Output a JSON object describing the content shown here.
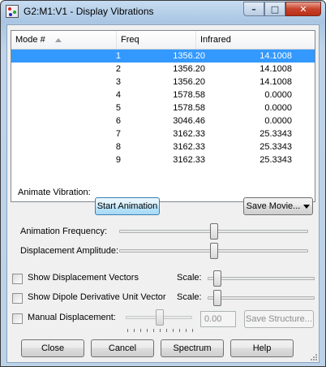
{
  "window": {
    "title": "G2:M1:V1 - Display Vibrations",
    "controls": {
      "minimize": "–",
      "maximize": "□",
      "close": "✕"
    }
  },
  "table": {
    "columns": [
      "Mode #",
      "Freq",
      "Infrared"
    ],
    "rows": [
      {
        "mode": "1",
        "freq": "1356.20",
        "ir": "14.1008"
      },
      {
        "mode": "2",
        "freq": "1356.20",
        "ir": "14.1008"
      },
      {
        "mode": "3",
        "freq": "1356.20",
        "ir": "14.1008"
      },
      {
        "mode": "4",
        "freq": "1578.58",
        "ir": "0.0000"
      },
      {
        "mode": "5",
        "freq": "1578.58",
        "ir": "0.0000"
      },
      {
        "mode": "6",
        "freq": "3046.46",
        "ir": "0.0000"
      },
      {
        "mode": "7",
        "freq": "3162.33",
        "ir": "25.3343"
      },
      {
        "mode": "8",
        "freq": "3162.33",
        "ir": "25.3343"
      },
      {
        "mode": "9",
        "freq": "3162.33",
        "ir": "25.3343"
      }
    ],
    "selected_row": 0
  },
  "animation": {
    "section_label": "Animate Vibration:",
    "start_button": "Start Animation",
    "save_movie_button": "Save Movie...",
    "frequency_label": "Animation Frequency:",
    "frequency_level": 0.5,
    "amplitude_label": "Displacement Amplitude:",
    "amplitude_level": 0.5
  },
  "options": {
    "show_vectors_label": "Show Displacement Vectors",
    "show_vectors_checked": false,
    "show_dipole_label": "Show Dipole Derivative Unit Vector",
    "show_dipole_checked": false,
    "scale_label": "Scale:",
    "manual_label": "Manual Displacement:",
    "manual_checked": false,
    "manual_value": "0.00",
    "save_structure_button": "Save Structure..."
  },
  "footer": {
    "close": "Close",
    "cancel": "Cancel",
    "spectrum": "Spectrum",
    "help": "Help"
  },
  "colors": {
    "selection": "#3399ff",
    "close_button": "#c8432c"
  }
}
